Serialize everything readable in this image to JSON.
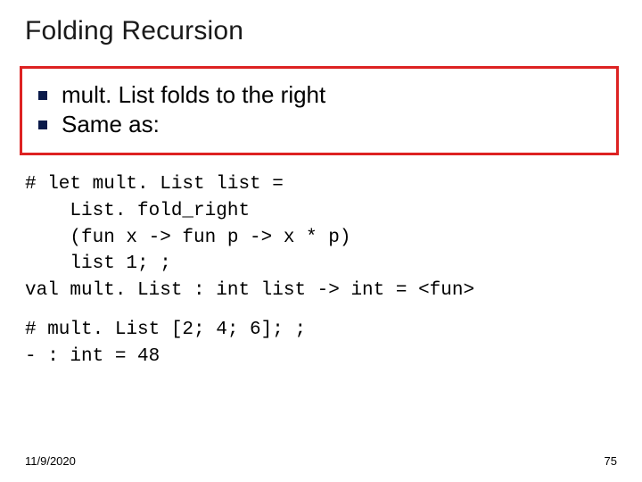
{
  "title": "Folding Recursion",
  "bullets": {
    "b1": "mult. List folds to the right",
    "b2": "Same as:"
  },
  "code": {
    "block1": "# let mult. List list =\n    List. fold_right\n    (fun x -> fun p -> x * p)\n    list 1; ;\nval mult. List : int list -> int = <fun>",
    "block2": "# mult. List [2; 4; 6]; ;\n- : int = 48"
  },
  "footer": {
    "date": "11/9/2020",
    "page": "75"
  }
}
